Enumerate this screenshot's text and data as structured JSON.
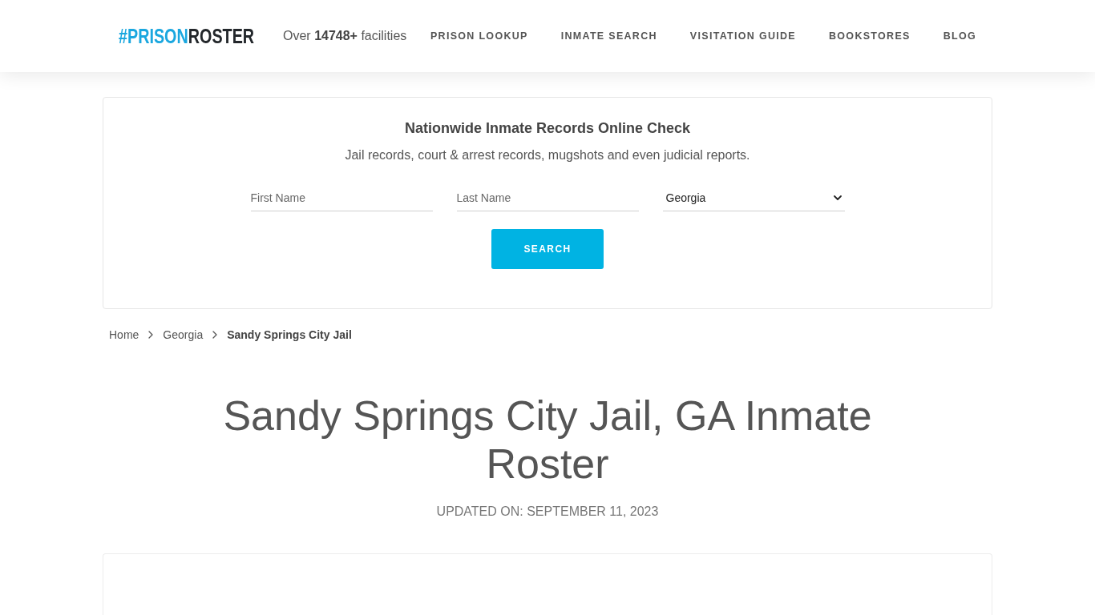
{
  "header": {
    "logo": {
      "highlight": "#PRISON",
      "text": "ROSTER"
    },
    "tagline": "Over **14748+** facilities",
    "nav": [
      "PRISON LOOKUP",
      "INMATE SEARCH",
      "VISITATION GUIDE",
      "BOOKSTORES",
      "BLOG"
    ]
  },
  "search_panel": {
    "title": "Nationwide Inmate Records Online Check",
    "subtitle": "Jail records, court & arrest records, mugshots and even judicial reports.",
    "fields": [
      {
        "kind": "input",
        "placeholder": "First Name"
      },
      {
        "kind": "input",
        "placeholder": "Last Name"
      },
      {
        "kind": "select",
        "value": "Georgia"
      }
    ],
    "button": "SEARCH"
  },
  "breadcrumb": [
    {
      "label": "Home",
      "current": false
    },
    {
      "label": "Georgia",
      "current": false
    },
    {
      "label": "Sandy Springs City Jail",
      "current": true
    }
  ],
  "page": {
    "title": "Sandy Springs City Jail, GA Inmate Roster",
    "updated": "UPDATED ON: SEPTEMBER 11, 2023"
  }
}
